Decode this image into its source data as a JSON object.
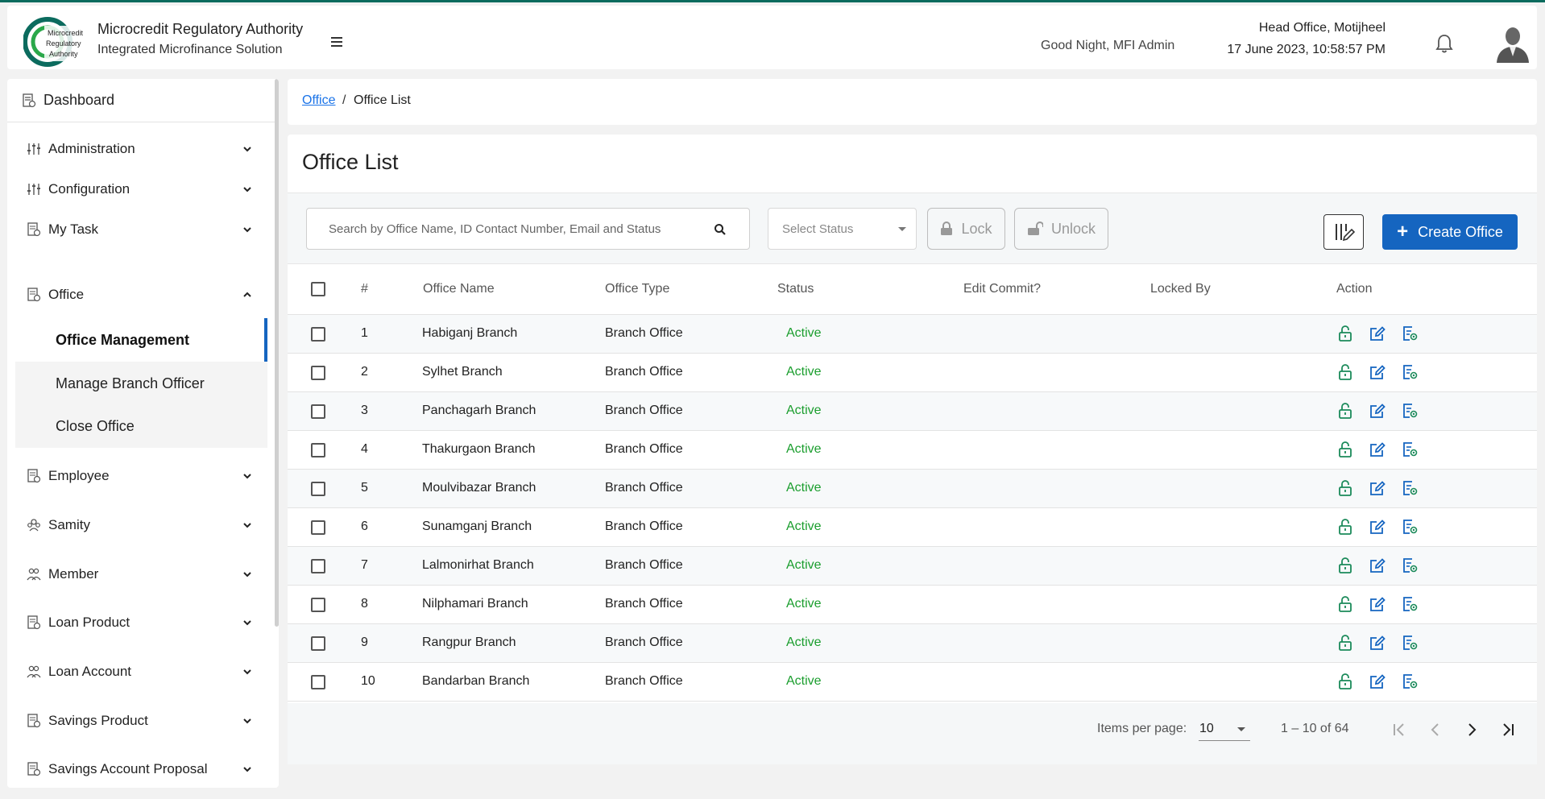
{
  "header": {
    "brand_title": "Microcredit Regulatory Authority",
    "brand_subtitle": "Integrated Microfinance Solution",
    "logo_text_1": "Microcredit",
    "logo_text_2": "Regulatory",
    "logo_text_3": "Authority",
    "greeting": "Good Night, MFI Admin",
    "office": "Head Office, Motijheel",
    "datetime": "17 June 2023, 10:58:57 PM"
  },
  "sidebar": {
    "dashboard": "Dashboard",
    "items": [
      {
        "label": "Administration",
        "icon": "sliders-icon"
      },
      {
        "label": "Configuration",
        "icon": "sliders-icon"
      },
      {
        "label": "My Task",
        "icon": "document-icon"
      },
      {
        "label": "Office",
        "icon": "document-icon"
      },
      {
        "label": "Employee",
        "icon": "document-icon"
      },
      {
        "label": "Samity",
        "icon": "group-icon"
      },
      {
        "label": "Member",
        "icon": "people-icon"
      },
      {
        "label": "Loan Product",
        "icon": "document-icon"
      },
      {
        "label": "Loan Account",
        "icon": "people-icon"
      },
      {
        "label": "Savings Product",
        "icon": "document-icon"
      },
      {
        "label": "Savings Account Proposal",
        "icon": "document-icon"
      }
    ],
    "office_submenu": [
      {
        "label": "Office Management",
        "active": true
      },
      {
        "label": "Manage Branch Officer",
        "active": false
      },
      {
        "label": "Close Office",
        "active": false
      }
    ]
  },
  "breadcrumb": {
    "parent": "Office",
    "separator": "/",
    "current": "Office List"
  },
  "main": {
    "title": "Office List",
    "search_placeholder": "Search by Office Name, ID Contact Number, Email and Status",
    "status_placeholder": "Select Status",
    "lock_label": "Lock",
    "unlock_label": "Unlock",
    "create_label": "Create Office"
  },
  "table": {
    "columns": [
      "#",
      "Office Name",
      "Office Type",
      "Status",
      "Edit Commit?",
      "Locked By",
      "Action"
    ],
    "rows": [
      {
        "no": "1",
        "name": "Habiganj Branch",
        "type": "Branch Office",
        "status": "Active",
        "edit_commit": "",
        "locked_by": ""
      },
      {
        "no": "2",
        "name": "Sylhet Branch",
        "type": "Branch Office",
        "status": "Active",
        "edit_commit": "",
        "locked_by": ""
      },
      {
        "no": "3",
        "name": "Panchagarh Branch",
        "type": "Branch Office",
        "status": "Active",
        "edit_commit": "",
        "locked_by": ""
      },
      {
        "no": "4",
        "name": "Thakurgaon Branch",
        "type": "Branch Office",
        "status": "Active",
        "edit_commit": "",
        "locked_by": ""
      },
      {
        "no": "5",
        "name": "Moulvibazar Branch",
        "type": "Branch Office",
        "status": "Active",
        "edit_commit": "",
        "locked_by": ""
      },
      {
        "no": "6",
        "name": "Sunamganj Branch",
        "type": "Branch Office",
        "status": "Active",
        "edit_commit": "",
        "locked_by": ""
      },
      {
        "no": "7",
        "name": "Lalmonirhat Branch",
        "type": "Branch Office",
        "status": "Active",
        "edit_commit": "",
        "locked_by": ""
      },
      {
        "no": "8",
        "name": "Nilphamari Branch",
        "type": "Branch Office",
        "status": "Active",
        "edit_commit": "",
        "locked_by": ""
      },
      {
        "no": "9",
        "name": "Rangpur Branch",
        "type": "Branch Office",
        "status": "Active",
        "edit_commit": "",
        "locked_by": ""
      },
      {
        "no": "10",
        "name": "Bandarban Branch",
        "type": "Branch Office",
        "status": "Active",
        "edit_commit": "",
        "locked_by": ""
      }
    ]
  },
  "pagination": {
    "items_per_page_label": "Items per page:",
    "items_per_page": "10",
    "range": "1 – 10 of 64"
  },
  "colors": {
    "accent": "#1565c0",
    "active_status": "#1b9e2e",
    "action_icon": "#1b8a5a",
    "edit_icon": "#1565c0",
    "brand_green": "#0b6b5e"
  }
}
